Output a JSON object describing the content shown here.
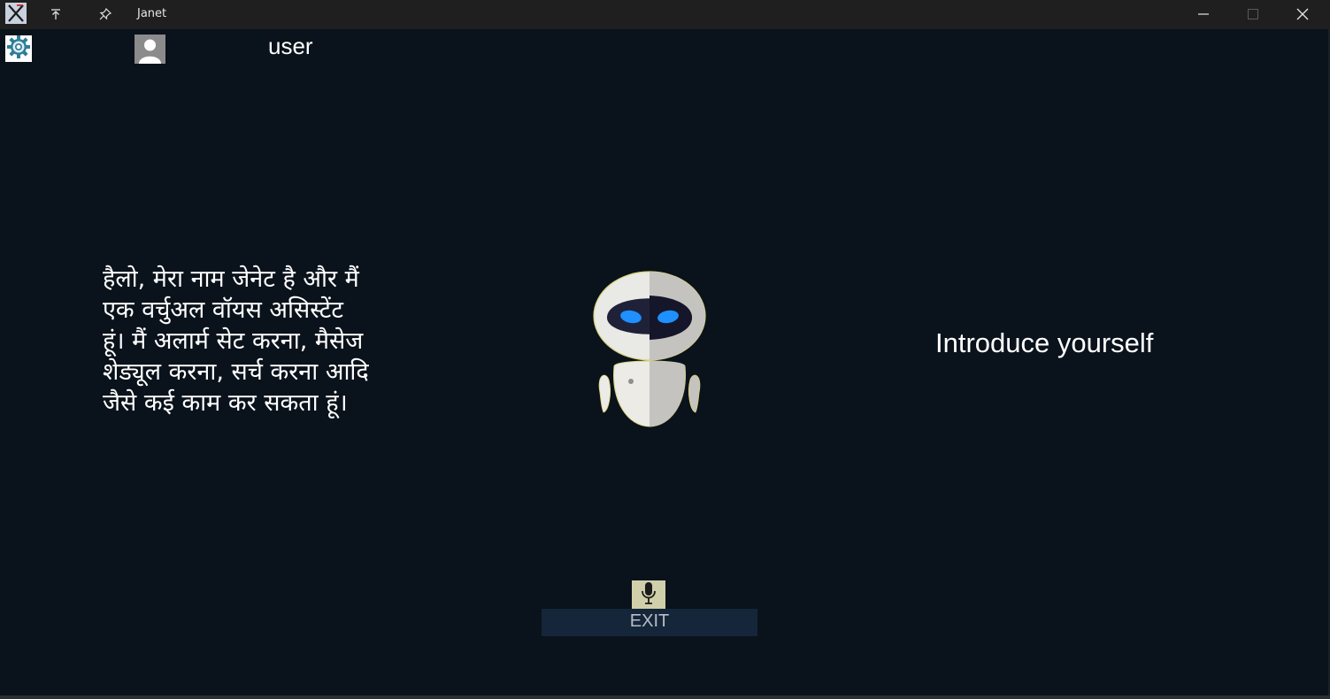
{
  "window": {
    "title": "Janet",
    "app_icon": "x-app-icon",
    "toolbar_icons": [
      "keep-on-top-icon",
      "pin-icon"
    ],
    "controls": [
      "minimize-icon",
      "maximize-icon",
      "close-icon"
    ]
  },
  "header": {
    "settings_icon": "gear-icon",
    "avatar_icon": "user-avatar-icon",
    "username": "user"
  },
  "conversation": {
    "assistant_lines": [
      "हैलो, मेरा नाम जेनेट है और मैं",
      "एक वर्चुअल वॉयस असिस्टेंट",
      "हूं। मैं अलार्म सेट करना, मैसेज",
      "शेड्यूल करना, सर्च करना आदि",
      "जैसे कई काम कर सकता हूं।"
    ],
    "user_query": "Introduce yourself"
  },
  "assistant": {
    "avatar": "robot-icon"
  },
  "controls": {
    "mic_icon": "microphone-icon",
    "exit_label": "EXIT"
  },
  "colors": {
    "background": "#0a121b",
    "titlebar": "#1f1f1f",
    "exit_button": "#15263a",
    "robot_eye": "#1e90ff",
    "text": "#ffffff"
  }
}
